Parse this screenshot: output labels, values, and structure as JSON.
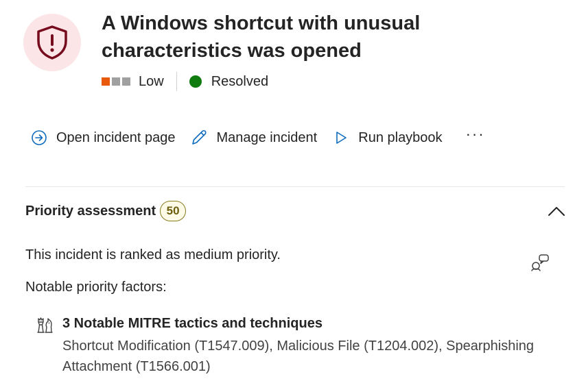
{
  "alert": {
    "title": "A Windows shortcut with unusual characteristics was opened",
    "icon": "shield-alert-icon",
    "severity": {
      "label": "Low",
      "colors": [
        "#e8590c",
        "#a0a0a0",
        "#a0a0a0"
      ]
    },
    "status": {
      "label": "Resolved",
      "color": "#107c10"
    }
  },
  "toolbar": {
    "open_incident_label": "Open incident page",
    "manage_incident_label": "Manage incident",
    "run_playbook_label": "Run playbook",
    "more_label": "···"
  },
  "priority": {
    "section_title": "Priority assessment",
    "score": "50",
    "ranking_text": "This incident is ranked as medium priority.",
    "factors_heading": "Notable priority factors:",
    "factor": {
      "title": "3 Notable MITRE tactics and techniques",
      "description": "Shortcut Modification (T1547.009), Malicious File (T1204.002), Spearphishing Attachment (T1566.001)"
    }
  },
  "colors": {
    "accent": "#0f6cbd",
    "shield_bg": "#fbe5e7",
    "shield_fg": "#750b1c"
  }
}
